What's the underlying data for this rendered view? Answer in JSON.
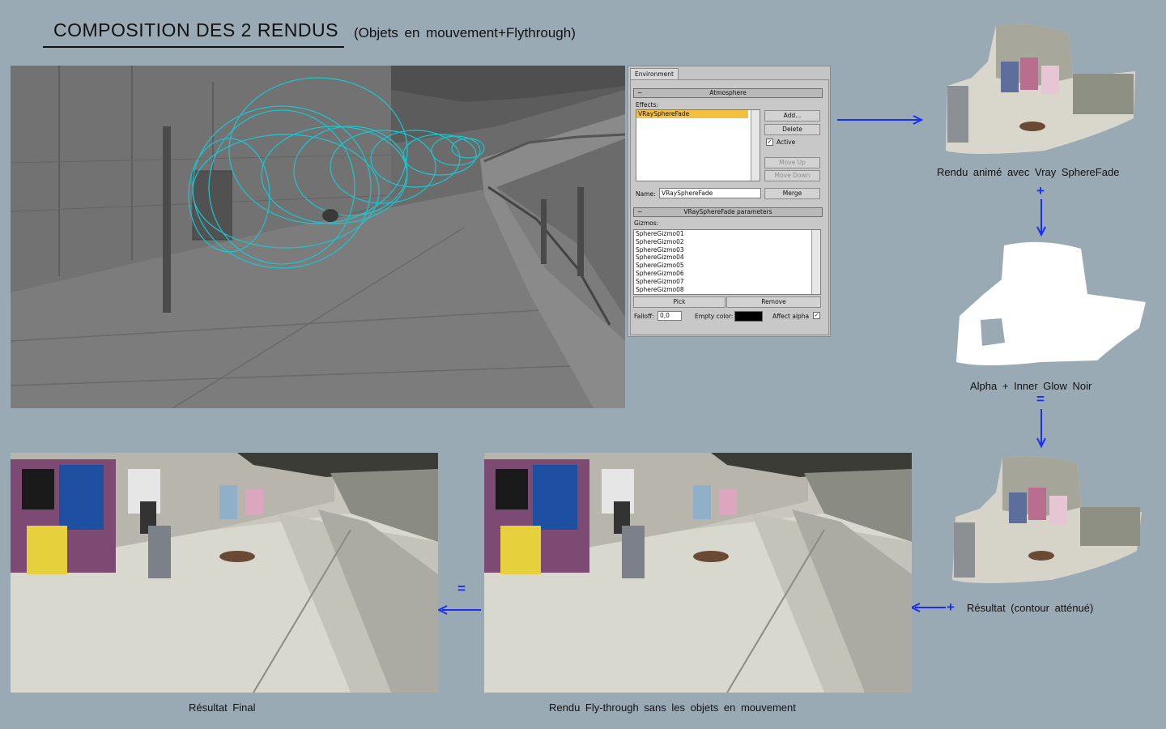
{
  "header": {
    "title": "COMPOSITION DES 2 RENDUS",
    "subtitle": "(Objets en mouvement+Flythrough)"
  },
  "dialog": {
    "tab_label": "Environment",
    "atmosphere_header": "Atmosphere",
    "effects_label": "Effects:",
    "effects_items": [
      "VRaySphereFade"
    ],
    "add_button": "Add...",
    "delete_button": "Delete",
    "active_label": "Active",
    "active_checked": true,
    "move_up_button": "Move Up",
    "move_down_button": "Move Down",
    "name_label": "Name:",
    "name_value": "VRaySphereFade",
    "merge_button": "Merge",
    "params_header": "VRaySphereFade parameters",
    "gizmos_label": "Gizmos:",
    "gizmos": [
      "SphereGizmo01",
      "SphereGizmo02",
      "SphereGizmo03",
      "SphereGizmo04",
      "SphereGizmo05",
      "SphereGizmo06",
      "SphereGizmo07",
      "SphereGizmo08"
    ],
    "pick_button": "Pick",
    "remove_button": "Remove",
    "falloff_label": "Falloff:",
    "falloff_value": "0,0",
    "empty_color_label": "Empty color:",
    "empty_color": "#000000",
    "affect_alpha_label": "Affect alpha",
    "affect_alpha_checked": true
  },
  "labels": {
    "render_sphere": "Rendu animé avec Vray SphereFade",
    "alpha": "Alpha + Inner Glow Noir",
    "result_soft": "Résultat (contour atténué)",
    "final": "Résultat Final",
    "flythrough": "Rendu Fly-through sans les objets en mouvement"
  },
  "symbols": {
    "plus": "+",
    "equals": "="
  },
  "colors": {
    "background": "#99aab5",
    "arrow": "#1a2ef5",
    "highlight": "#f3c13f",
    "gizmo": "#19c6d0"
  }
}
